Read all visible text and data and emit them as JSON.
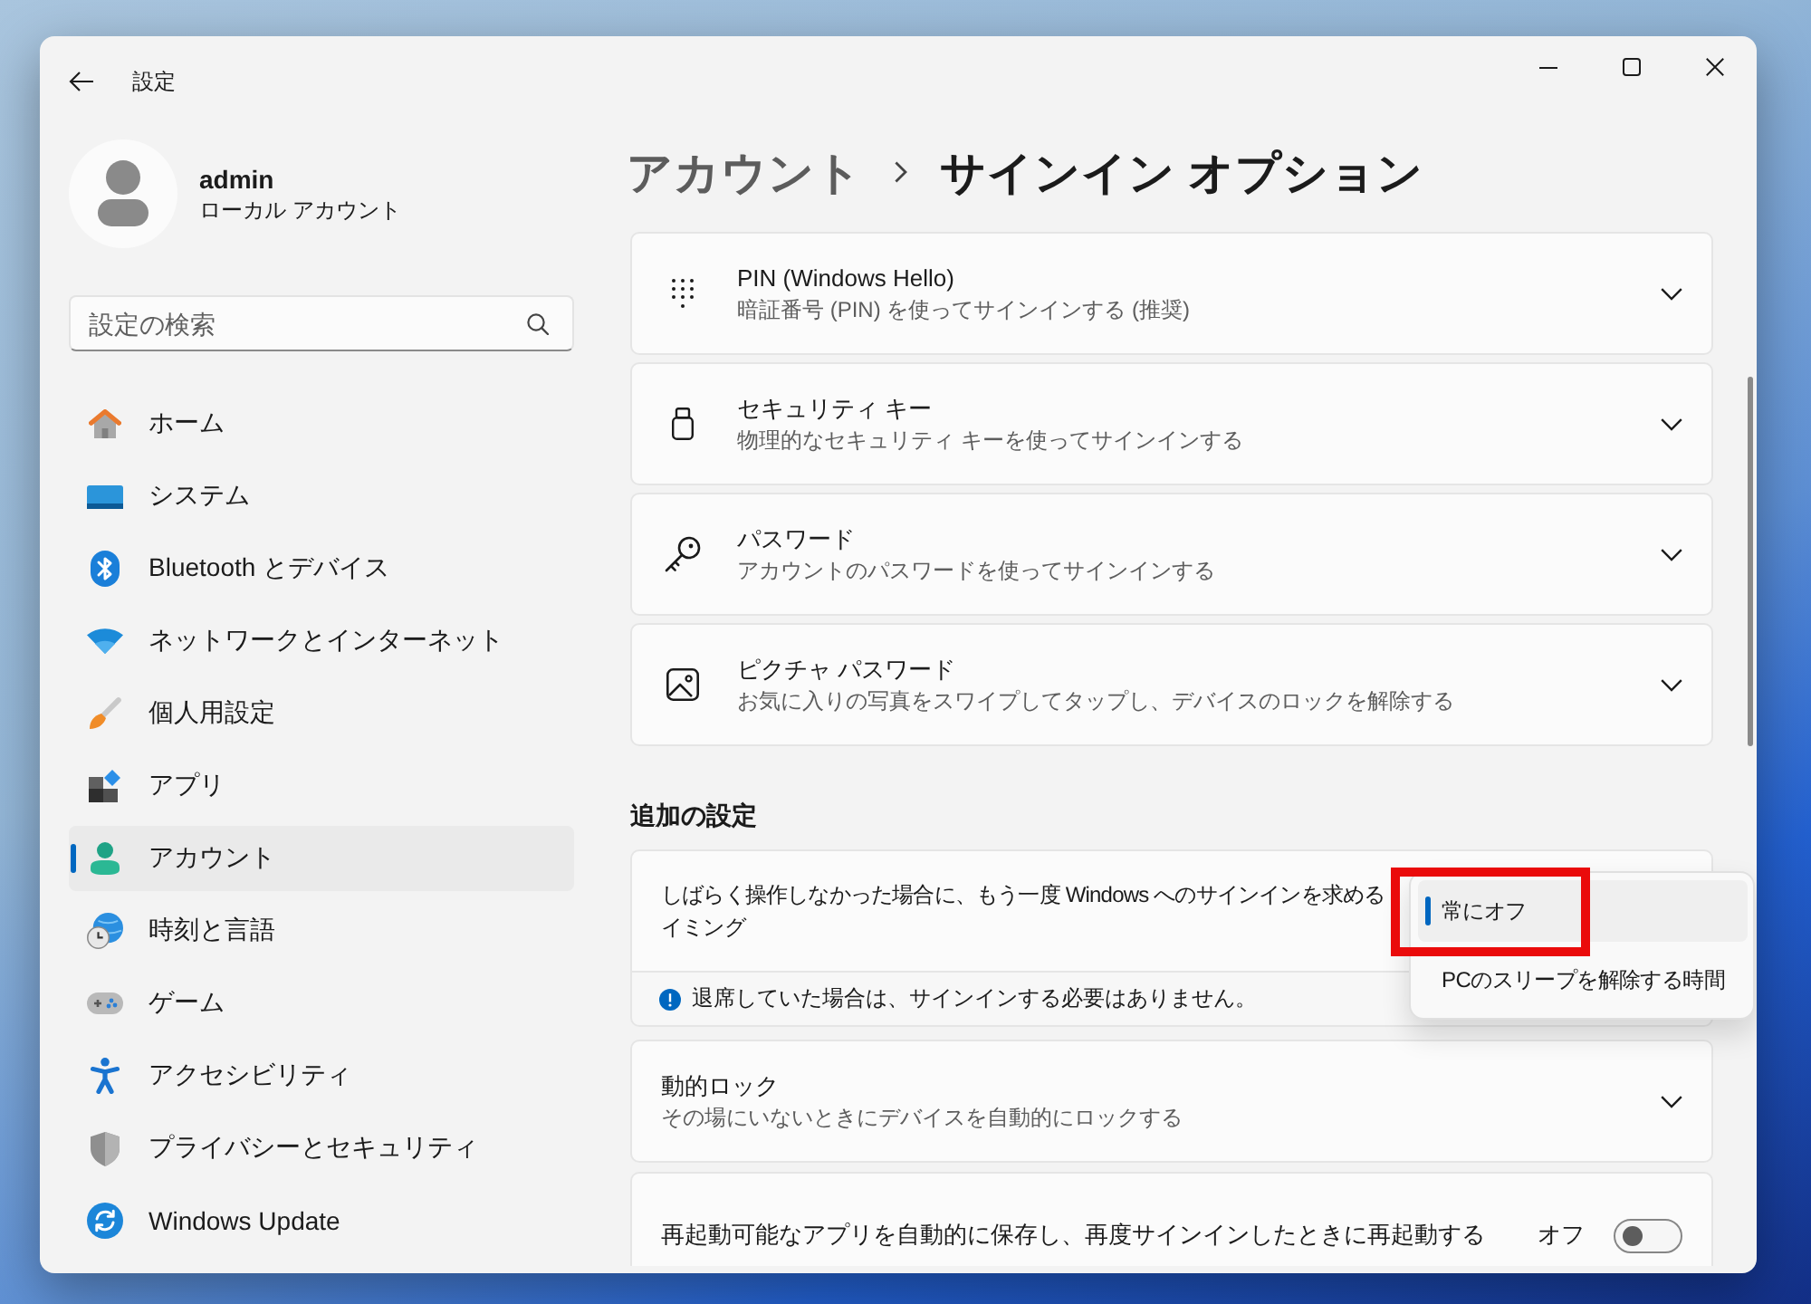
{
  "window": {
    "title": "設定"
  },
  "profile": {
    "name": "admin",
    "account_type": "ローカル アカウント"
  },
  "search": {
    "placeholder": "設定の検索"
  },
  "nav": [
    {
      "label": "ホーム",
      "selected": false
    },
    {
      "label": "システム",
      "selected": false
    },
    {
      "label": "Bluetooth とデバイス",
      "selected": false
    },
    {
      "label": "ネットワークとインターネット",
      "selected": false
    },
    {
      "label": "個人用設定",
      "selected": false
    },
    {
      "label": "アプリ",
      "selected": false
    },
    {
      "label": "アカウント",
      "selected": true
    },
    {
      "label": "時刻と言語",
      "selected": false
    },
    {
      "label": "ゲーム",
      "selected": false
    },
    {
      "label": "アクセシビリティ",
      "selected": false
    },
    {
      "label": "プライバシーとセキュリティ",
      "selected": false
    },
    {
      "label": "Windows Update",
      "selected": false
    }
  ],
  "breadcrumb": {
    "parent": "アカウント",
    "current": "サインイン オプション"
  },
  "sign_in_options": [
    {
      "title": "PIN (Windows Hello)",
      "subtitle": "暗証番号 (PIN) を使ってサインインする (推奨)",
      "expanded": false
    },
    {
      "title": "セキュリティ キー",
      "subtitle": "物理的なセキュリティ キーを使ってサインインする",
      "expanded": false
    },
    {
      "title": "パスワード",
      "subtitle": "アカウントのパスワードを使ってサインインする",
      "expanded": false
    },
    {
      "title": "ピクチャ パスワード",
      "subtitle": "お気に入りの写真をスワイプしてタップし、デバイスのロックを解除する",
      "expanded": false
    }
  ],
  "additional_settings": {
    "heading": "追加の設定",
    "items": [
      {
        "kind": "dropdown",
        "label_lines": [
          "しばらく操作しなかった場合に、もう一度 Windows へのサインインを求める",
          "イミング"
        ],
        "note": "退席していた場合は、サインインする必要はありません。",
        "options": [
          {
            "label": "常にオフ",
            "selected": true,
            "highlighted": true
          },
          {
            "label": "PCのスリープを解除する時間",
            "selected": false,
            "highlighted": false
          }
        ]
      },
      {
        "kind": "expander",
        "title": "動的ロック",
        "subtitle": "その場にいないときにデバイスを自動的にロックする",
        "expanded": false
      },
      {
        "kind": "toggle",
        "label": "再起動可能なアプリを自動的に保存し、再度サインインしたときに再起動する",
        "state_label": "オフ",
        "on": false
      }
    ]
  }
}
